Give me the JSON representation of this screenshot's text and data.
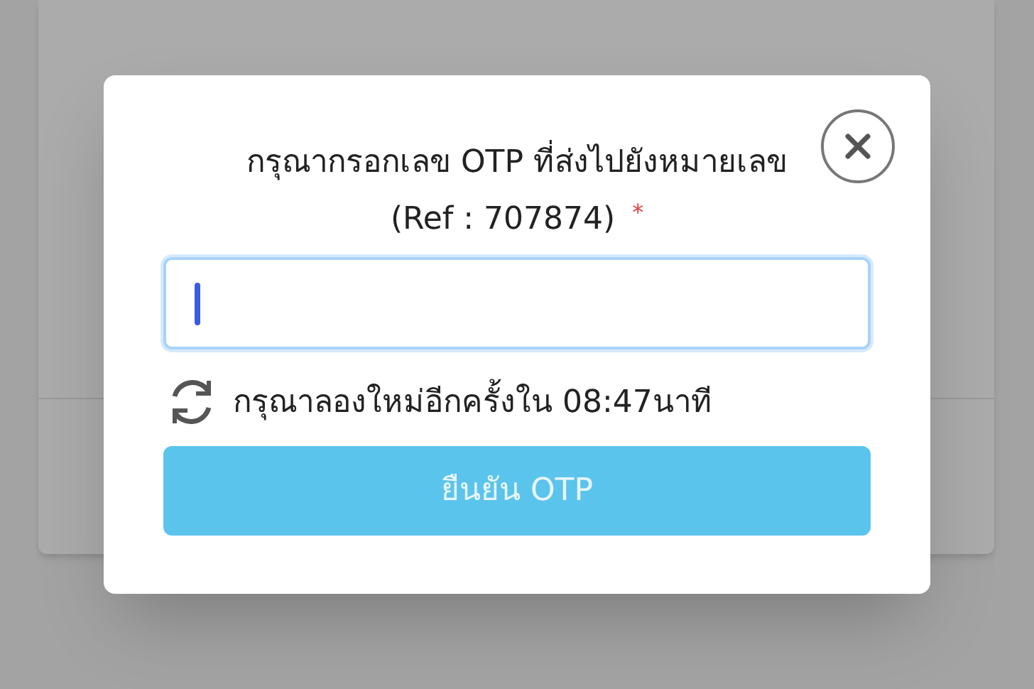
{
  "dialog": {
    "title": "กรุณากรอกเลข OTP ที่ส่งไปยังหมายเลข",
    "reference": "(Ref : 707874)",
    "required_mark": "*",
    "otp_field": {
      "focused": true
    },
    "resend_notice": "กรุณาลองใหม่อีกครั้งใน 08:47นาที",
    "confirm_button": {
      "label": "ยืนยัน OTP",
      "disabled": true
    }
  }
}
